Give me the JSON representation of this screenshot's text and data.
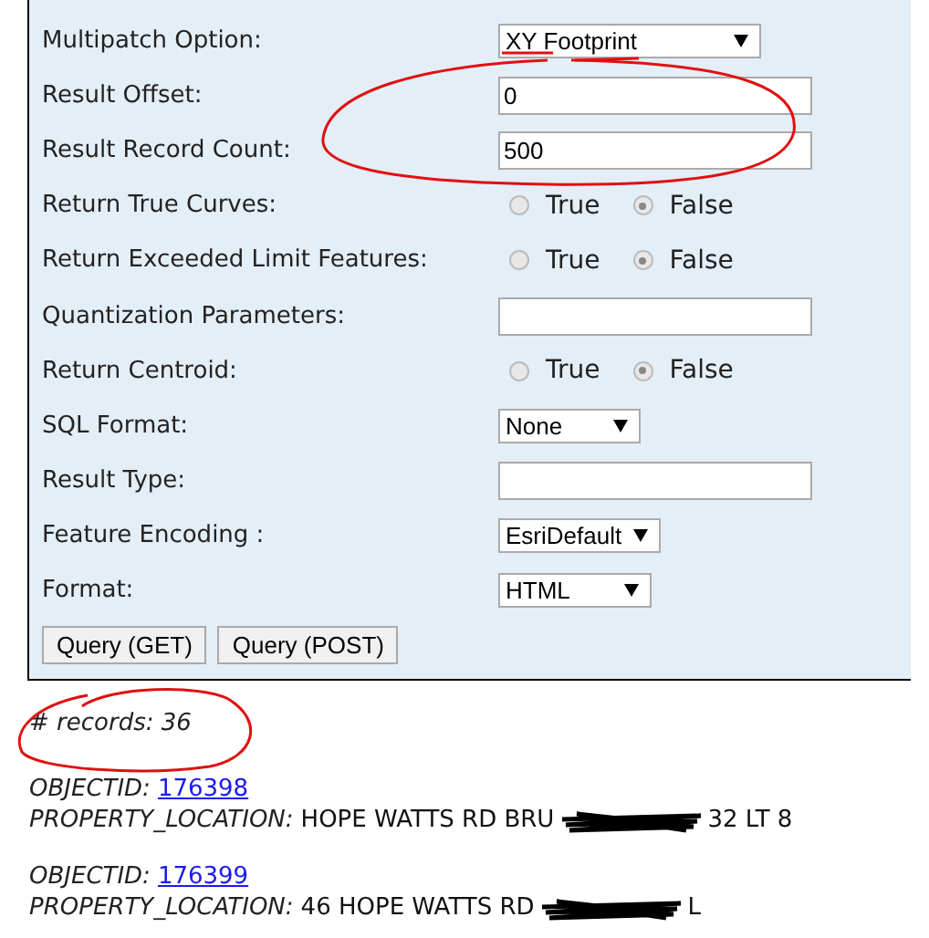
{
  "form": {
    "fields": [
      {
        "label": "Multipatch Option:",
        "kind": "select",
        "value": "XY Footprint"
      },
      {
        "label": "Result Offset:",
        "kind": "text",
        "value": "0"
      },
      {
        "label": "Result Record Count:",
        "kind": "text",
        "value": "500"
      },
      {
        "label": "Return True Curves:",
        "kind": "radio",
        "options": [
          {
            "label": "True",
            "selected": false
          },
          {
            "label": "False",
            "selected": true
          }
        ]
      },
      {
        "label": "Return Exceeded Limit Features:",
        "kind": "radio",
        "options": [
          {
            "label": "True",
            "selected": false
          },
          {
            "label": "False",
            "selected": true
          }
        ]
      },
      {
        "label": "Quantization Parameters:",
        "kind": "text"
      },
      {
        "label": "Return Centroid:",
        "kind": "radio",
        "options": [
          {
            "label": "True",
            "selected": false
          },
          {
            "label": "False",
            "selected": true
          }
        ]
      },
      {
        "label": "SQL Format:",
        "kind": "select",
        "value": "None"
      },
      {
        "label": "Result Type:",
        "kind": "text"
      },
      {
        "label": "Feature Encoding :",
        "kind": "select",
        "value": "EsriDefault"
      },
      {
        "label": "Format:",
        "kind": "select",
        "value": "HTML"
      }
    ],
    "buttons": [
      "Query (GET)",
      "Query (POST)"
    ]
  },
  "records_count": "# records: 36",
  "records": [
    {
      "id_label": "OBJECTID:",
      "id": "176398",
      "location_label": "PROPERTY_LOCATION:",
      "location_start": "HOPE WATTS RD BRU",
      "location_end": "32 LT 8"
    },
    {
      "id_label": "OBJECTID:",
      "id": "176399",
      "location_label": "PROPERTY_LOCATION:",
      "location_start": "46 HOPE WATTS RD",
      "location_end": "L"
    }
  ]
}
